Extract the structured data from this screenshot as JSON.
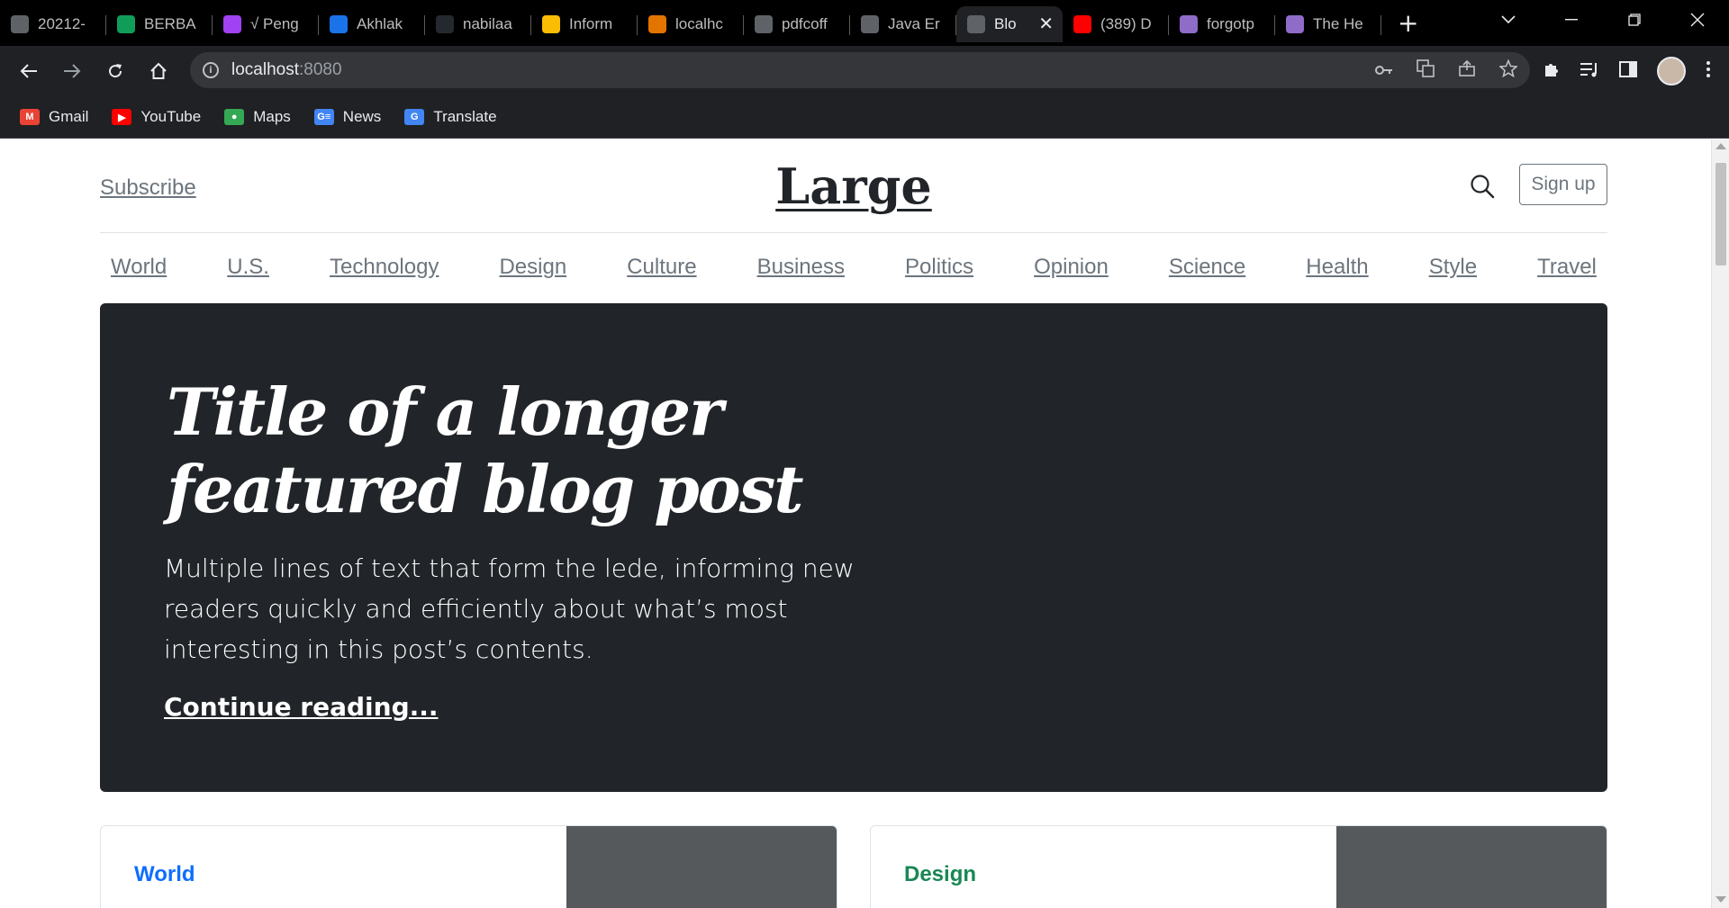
{
  "browser": {
    "tabs": [
      {
        "title": "20212-",
        "color": "#5f6368"
      },
      {
        "title": "BERBA",
        "color": "#0f9d58"
      },
      {
        "title": "√ Peng",
        "color": "#a142f4"
      },
      {
        "title": "Akhlak",
        "color": "#1a73e8"
      },
      {
        "title": "nabilaa",
        "color": "#24292f"
      },
      {
        "title": "Inform",
        "color": "#fbbc04"
      },
      {
        "title": "localhc",
        "color": "#e37400"
      },
      {
        "title": "pdfcoff",
        "color": "#5f6368"
      },
      {
        "title": "Java Er",
        "color": "#5f6368"
      },
      {
        "title": "Blo",
        "color": "#5f6368",
        "active": true
      },
      {
        "title": "(389) D",
        "color": "#ff0000"
      },
      {
        "title": "forgotp",
        "color": "#8e6cc8"
      },
      {
        "title": "The He",
        "color": "#8e6cc8"
      }
    ],
    "new_tab": "+",
    "url_host": "localhost",
    "url_port": ":8080",
    "bookmarks": [
      {
        "label": "Gmail",
        "icon": "gmail-icon",
        "color": "#ea4335",
        "glyph": "M"
      },
      {
        "label": "YouTube",
        "icon": "youtube-icon",
        "color": "#ff0000",
        "glyph": "▶"
      },
      {
        "label": "Maps",
        "icon": "maps-icon",
        "color": "#34a853",
        "glyph": "●"
      },
      {
        "label": "News",
        "icon": "news-icon",
        "color": "#4285f4",
        "glyph": "G≡"
      },
      {
        "label": "Translate",
        "icon": "translate-icon",
        "color": "#4285f4",
        "glyph": "G"
      }
    ]
  },
  "page": {
    "subscribe": "Subscribe",
    "logo": "Large",
    "signup": "Sign up",
    "nav": [
      "World",
      "U.S.",
      "Technology",
      "Design",
      "Culture",
      "Business",
      "Politics",
      "Opinion",
      "Science",
      "Health",
      "Style",
      "Travel"
    ],
    "hero": {
      "title": "Title of a longer featured blog post",
      "lede": "Multiple lines of text that form the lede, informing new readers quickly and efficiently about what’s most interesting in this post’s contents.",
      "link": "Continue reading..."
    },
    "cards": [
      {
        "category": "World",
        "color": "#0d6efd"
      },
      {
        "category": "Design",
        "color": "#198754"
      }
    ]
  }
}
